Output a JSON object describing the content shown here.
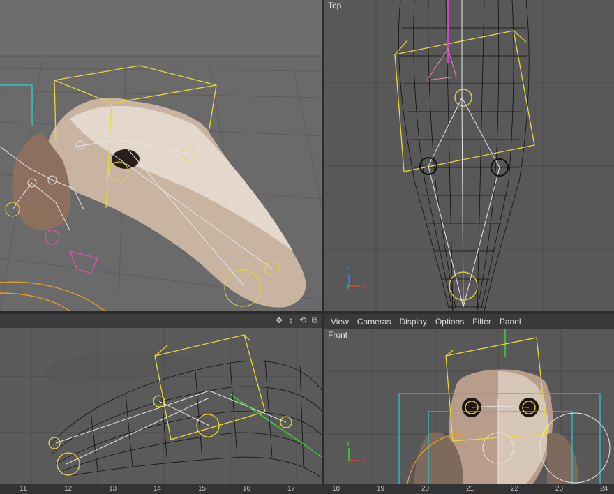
{
  "viewports": {
    "top": {
      "label": "Top"
    },
    "front": {
      "label": "Front"
    }
  },
  "menu": {
    "view": "View",
    "cameras": "Cameras",
    "display": "Display",
    "options": "Options",
    "filter": "Filter",
    "panel": "Panel"
  },
  "ruler": [
    "11",
    "12",
    "13",
    "14",
    "15",
    "16",
    "17",
    "18",
    "19",
    "20",
    "21",
    "22",
    "23",
    "24"
  ],
  "colors": {
    "selection": "#e8d83a",
    "joint": "#e6e6e6",
    "cyan": "#2ec4c4"
  }
}
